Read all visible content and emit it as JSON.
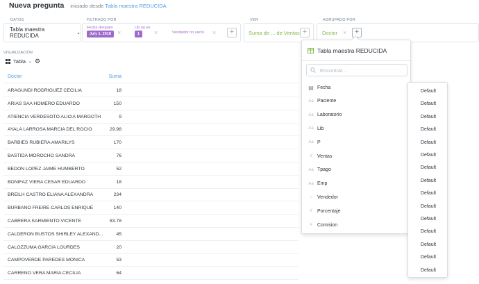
{
  "header": {
    "title": "Nueva pregunta",
    "subtitle_prefix": "iniciado desde",
    "source_link": "Tabla maestra REDUCIDA"
  },
  "query": {
    "datos_label": "DATOS",
    "datos_value": "Tabla maestra REDUCIDA",
    "filtro_label": "FILTRADO POR",
    "filters": [
      {
        "label": "Fecha después",
        "value": "July 1, 2018"
      },
      {
        "label": "Lib no es",
        "value": "1"
      },
      {
        "label": "Vendedor no vacío",
        "value": ""
      }
    ],
    "ver_label": "VER",
    "ver_value": "Suma de ... de Ventas",
    "agrupado_label": "AGRUPADO POR",
    "agrupado_value": "Doctor"
  },
  "visualization": {
    "label": "VISUALIZACIÓN",
    "type": "Tabla"
  },
  "table": {
    "columns": [
      "Doctor",
      "Suma"
    ],
    "rows": [
      {
        "name": "ARAGUNDI RODRIGUEZ CECILIA",
        "value": "18"
      },
      {
        "name": "ARIAS SAA HOMERO EDUARDO",
        "value": "150"
      },
      {
        "name": "ATIENCIA VERDESOTO ALICIA MARGOTH",
        "value": "9"
      },
      {
        "name": "AYALA LARROSA MARCIA DEL ROCIO",
        "value": "29.98"
      },
      {
        "name": "BARBIES RUBIERA AMARILYS",
        "value": "170"
      },
      {
        "name": "BASTIDA MOROCHO SANDRA",
        "value": "76"
      },
      {
        "name": "BEDON LOPEZ JAIME HUMBERTO",
        "value": "52"
      },
      {
        "name": "BONIFAZ VIERA CESAR EDUARDO",
        "value": "18"
      },
      {
        "name": "BREILH CASTRO ELIANA ALEXANDRA",
        "value": "234"
      },
      {
        "name": "BURBANO FREIRE CARLOS ENRIQUE",
        "value": "140"
      },
      {
        "name": "CABRERA SARMIENTO VICENTE",
        "value": "83.78"
      },
      {
        "name": "CALDERON BUSTOS SHIRLEY ALEXAND...",
        "value": "45"
      },
      {
        "name": "CALOZZUMA GARCIA LOURDES",
        "value": "20"
      },
      {
        "name": "CAMPOVERDE PAREDES MONICA",
        "value": "53"
      },
      {
        "name": "CARRENO VERA MARIA CECILIA",
        "value": "64"
      }
    ]
  },
  "popover": {
    "title": "Tabla maestra REDUCIDA",
    "search_placeholder": "Encontrar...",
    "fields": [
      {
        "icon": "calendar-icon",
        "label": "Fecha"
      },
      {
        "icon": "text-icon",
        "label": "Paciente"
      },
      {
        "icon": "text-icon",
        "label": "Laboratorio"
      },
      {
        "icon": "text-icon",
        "label": "Lib"
      },
      {
        "icon": "text-icon",
        "label": "P"
      },
      {
        "icon": "number-icon",
        "label": "Ventas"
      },
      {
        "icon": "text-icon",
        "label": "Tpago"
      },
      {
        "icon": "text-icon",
        "label": "Emp"
      },
      {
        "icon": "circle-icon",
        "label": "Vendedor"
      },
      {
        "icon": "number-icon",
        "label": "Porcentaje"
      },
      {
        "icon": "number-icon",
        "label": "Comision"
      }
    ]
  },
  "binning": {
    "options": [
      "Default",
      "Default",
      "Default",
      "Default",
      "Default",
      "Default",
      "Default",
      "Default",
      "Default",
      "Default",
      "Default",
      "Default",
      "Default",
      "Default",
      "Default"
    ]
  },
  "colors": {
    "brand_blue": "#509ee3",
    "filter_purple": "#9f6acd",
    "summarize_green": "#84bb4c",
    "text_dark": "#2e353b",
    "text_muted": "#74838f"
  }
}
